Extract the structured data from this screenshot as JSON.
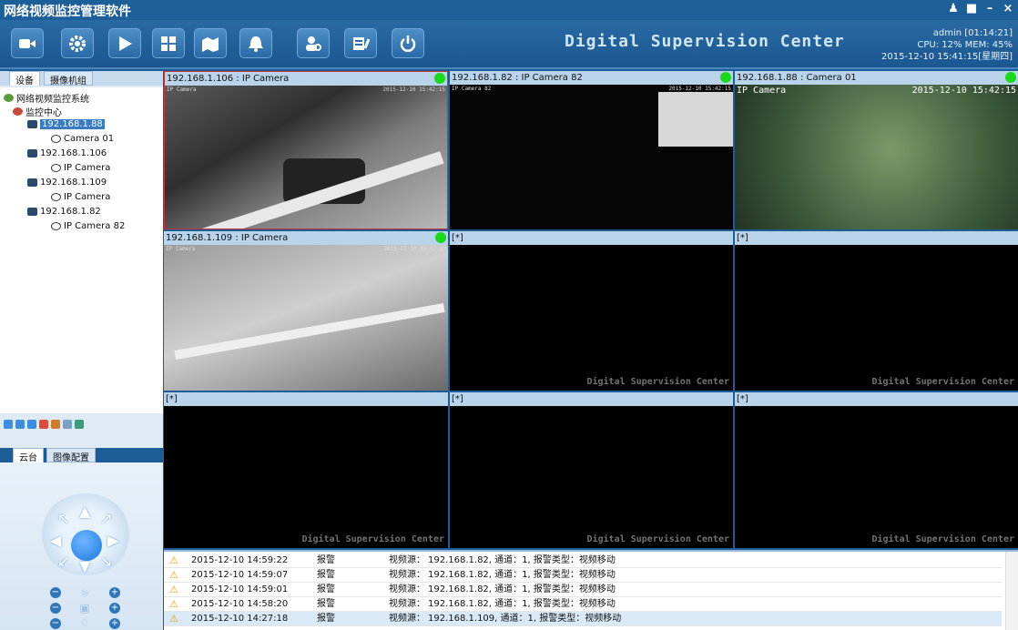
{
  "window": {
    "title": "网络视频监控管理软件",
    "controls": [
      "person",
      "lock",
      "–",
      "×"
    ]
  },
  "toolbar": {
    "buttons": [
      "camera-icon",
      "gear-icon",
      "play-icon",
      "grid-icon",
      "map-icon",
      "bell-icon",
      "user-search-icon",
      "log-icon",
      "power-icon"
    ],
    "brand": "Digital Supervision Center"
  },
  "sysinfo": {
    "user": "admin  [01:14:21]",
    "usage": "CPU: 12%  MEM: 45%",
    "datetime": "2015-12-10 15:41:15[星期四]"
  },
  "left_tabs": {
    "devices": "设备",
    "camera_group": "摄像机组"
  },
  "tree": {
    "root": "网络视频监控系统",
    "center": "监控中心",
    "nodes": [
      {
        "ip": "192.168.1.88",
        "camera": "Camera 01",
        "selected": true
      },
      {
        "ip": "192.168.1.106",
        "camera": "IP Camera"
      },
      {
        "ip": "192.168.1.109",
        "camera": "IP Camera"
      },
      {
        "ip": "192.168.1.82",
        "camera": "IP Camera 82"
      }
    ]
  },
  "ptz": {
    "tab_ptz": "云台",
    "tab_image": "图像配置"
  },
  "grid": {
    "cells": [
      {
        "title": "192.168.1.106 : IP Camera",
        "osd_name": "IP Camera",
        "osd_time": "2015-12-10 15:42:15",
        "active": true
      },
      {
        "title": "192.168.1.82 : IP Camera 82",
        "osd_name": "IP Camera 82",
        "osd_time": "2015-12-10 15:42:15",
        "active": true
      },
      {
        "title": "192.168.1.88 : Camera 01",
        "osd_name": "IP Camera",
        "osd_time": "2015-12-10 15:42:15",
        "active": true
      },
      {
        "title": "192.168.1.109 : IP Camera",
        "osd_name": "IP Camera",
        "osd_time": "2015-12-10 15:42:23",
        "active": true
      },
      {
        "title": "[*]",
        "watermark": "Digital Supervision Center"
      },
      {
        "title": "[*]",
        "watermark": "Digital Supervision Center"
      },
      {
        "title": "[*]",
        "watermark": "Digital Supervision Center"
      },
      {
        "title": "[*]",
        "watermark": "Digital Supervision Center"
      },
      {
        "title": "[*]",
        "watermark": "Digital Supervision Center"
      }
    ]
  },
  "log": {
    "rows": [
      {
        "time": "2015-12-10 14:59:22",
        "type": "报警",
        "label": "视频源：",
        "msg": "192.168.1.82, 通道：1, 报警类型：视频移动"
      },
      {
        "time": "2015-12-10 14:59:07",
        "type": "报警",
        "label": "视频源：",
        "msg": "192.168.1.82, 通道：1, 报警类型：视频移动"
      },
      {
        "time": "2015-12-10 14:59:01",
        "type": "报警",
        "label": "视频源：",
        "msg": "192.168.1.82, 通道：1, 报警类型：视频移动"
      },
      {
        "time": "2015-12-10 14:58:20",
        "type": "报警",
        "label": "视频源：",
        "msg": "192.168.1.82, 通道：1, 报警类型：视频移动"
      },
      {
        "time": "2015-12-10 14:27:18",
        "type": "报警",
        "label": "视频源：",
        "msg": "192.168.1.109, 通道：1, 报警类型：视频移动"
      }
    ]
  },
  "colors": {
    "titlebar": "#1d5f98",
    "accent": "#3a7cc2",
    "status_ok": "#19d919"
  }
}
